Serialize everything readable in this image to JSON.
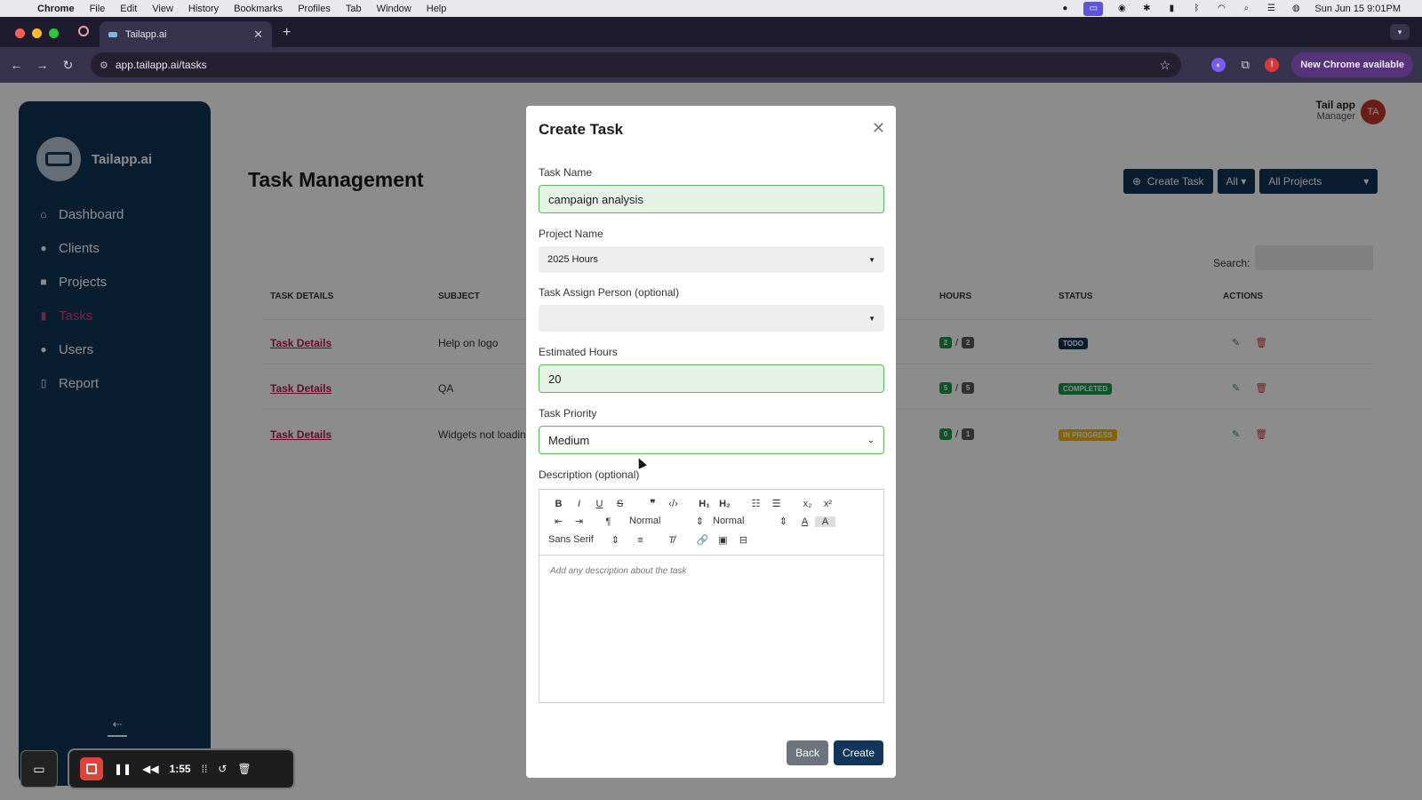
{
  "menubar": {
    "app": "Chrome",
    "items": [
      "File",
      "Edit",
      "View",
      "History",
      "Bookmarks",
      "Profiles",
      "Tab",
      "Window",
      "Help"
    ],
    "clock": "Sun Jun 15  9:01PM"
  },
  "browser": {
    "tab_title": "Tailapp.ai",
    "url": "app.tailapp.ai/tasks",
    "new_chrome_label": "New Chrome available"
  },
  "sidebar": {
    "brand": "Tailapp.ai",
    "items": [
      {
        "label": "Dashboard",
        "icon": "home-icon"
      },
      {
        "label": "Clients",
        "icon": "users-icon"
      },
      {
        "label": "Projects",
        "icon": "briefcase-icon"
      },
      {
        "label": "Tasks",
        "icon": "tasks-icon"
      },
      {
        "label": "Users",
        "icon": "users-icon"
      },
      {
        "label": "Report",
        "icon": "book-icon"
      }
    ],
    "active": "Tasks"
  },
  "user": {
    "name": "Tail app",
    "role": "Manager",
    "initials": "TA"
  },
  "page": {
    "title": "Task Management",
    "create_task_label": "Create Task",
    "filter_label": "All",
    "projects_label": "All Projects",
    "search_label": "Search:"
  },
  "table": {
    "headers": {
      "details": "TASK DETAILS",
      "subject": "SUBJECT",
      "hours": "HOURS",
      "status": "STATUS",
      "actions": "ACTIONS"
    },
    "rows": [
      {
        "link": "Task Details",
        "subject": "Help on logo",
        "spent": "2",
        "total": "2",
        "status": "TODO"
      },
      {
        "link": "Task Details",
        "subject": "QA",
        "spent": "5",
        "total": "5",
        "status": "COMPLETED"
      },
      {
        "link": "Task Details",
        "subject": "Widgets not loadin",
        "spent": "0",
        "total": "1",
        "status": "IN PROGRESS"
      }
    ]
  },
  "modal": {
    "title": "Create Task",
    "task_name_label": "Task Name",
    "task_name_value": "campaign analysis",
    "project_name_label": "Project Name",
    "project_name_value": "2025 Hours",
    "assign_label": "Task Assign Person (optional)",
    "assign_value": "",
    "hours_label": "Estimated Hours",
    "hours_value": "20",
    "priority_label": "Task Priority",
    "priority_value": "Medium",
    "description_label": "Description (optional)",
    "description_placeholder": "Add any description about the task",
    "toolbar": {
      "header_select": "Normal",
      "size_select": "Normal",
      "font_select": "Sans Serif"
    },
    "back_label": "Back",
    "create_label": "Create"
  },
  "recorder": {
    "time": "1:55"
  },
  "colors": {
    "brand": "#12355a",
    "accent": "#c0174f",
    "success": "#1c9a4c",
    "warning": "#f0b400"
  }
}
